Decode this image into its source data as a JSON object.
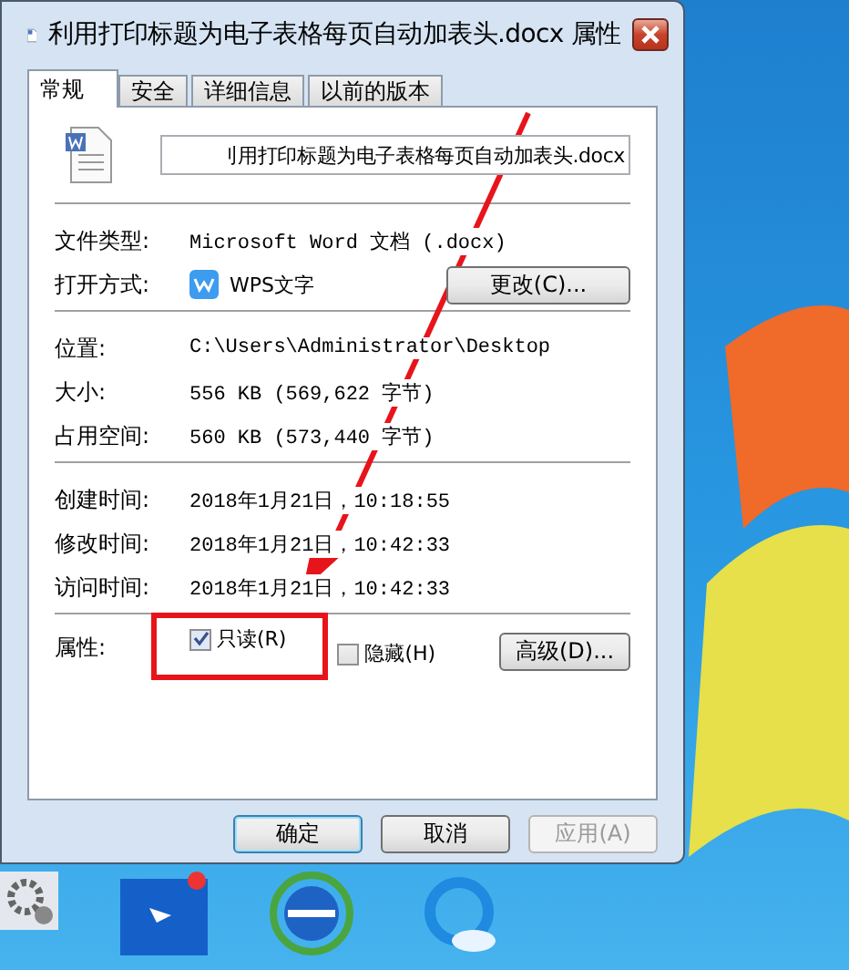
{
  "window": {
    "title": "利用打印标题为电子表格每页自动加表头.docx 属性"
  },
  "tabs": [
    {
      "label": "常规",
      "selected": true
    },
    {
      "label": "安全",
      "selected": false
    },
    {
      "label": "详细信息",
      "selected": false
    },
    {
      "label": "以前的版本",
      "selected": false
    }
  ],
  "file_name_field": {
    "value": "刂用打印标题为电子表格每页自动加表头.docx"
  },
  "sections": [
    [
      {
        "kind": "text",
        "label": "文件类型:",
        "value": "Microsoft Word 文档 (.docx)"
      },
      {
        "kind": "app",
        "label": "打开方式:",
        "value": "WPS文字",
        "button": "更改(C)..."
      }
    ],
    [
      {
        "kind": "text",
        "label": "位置:",
        "value": "C:\\Users\\Administrator\\Desktop"
      },
      {
        "kind": "text",
        "label": "大小:",
        "value": "556 KB (569,622 字节)"
      },
      {
        "kind": "text",
        "label": "占用空间:",
        "value": "560 KB (573,440 字节)"
      }
    ],
    [
      {
        "kind": "text",
        "label": "创建时间:",
        "value": "2018年1月21日，10:18:55"
      },
      {
        "kind": "text",
        "label": "修改时间:",
        "value": "2018年1月21日，10:42:33"
      },
      {
        "kind": "text",
        "label": "访问时间:",
        "value": "2018年1月21日，10:42:33"
      }
    ]
  ],
  "attributes": {
    "label": "属性:",
    "checkboxes": [
      {
        "label": "只读(R)",
        "checked": true,
        "highlighted": true
      },
      {
        "label": "隐藏(H)",
        "checked": false,
        "highlighted": false
      }
    ],
    "button": "高级(D)..."
  },
  "buttons": [
    {
      "label": "确定",
      "disabled": false,
      "default": true
    },
    {
      "label": "取消",
      "disabled": false,
      "default": false
    },
    {
      "label": "应用(A)",
      "disabled": true,
      "default": false
    }
  ]
}
